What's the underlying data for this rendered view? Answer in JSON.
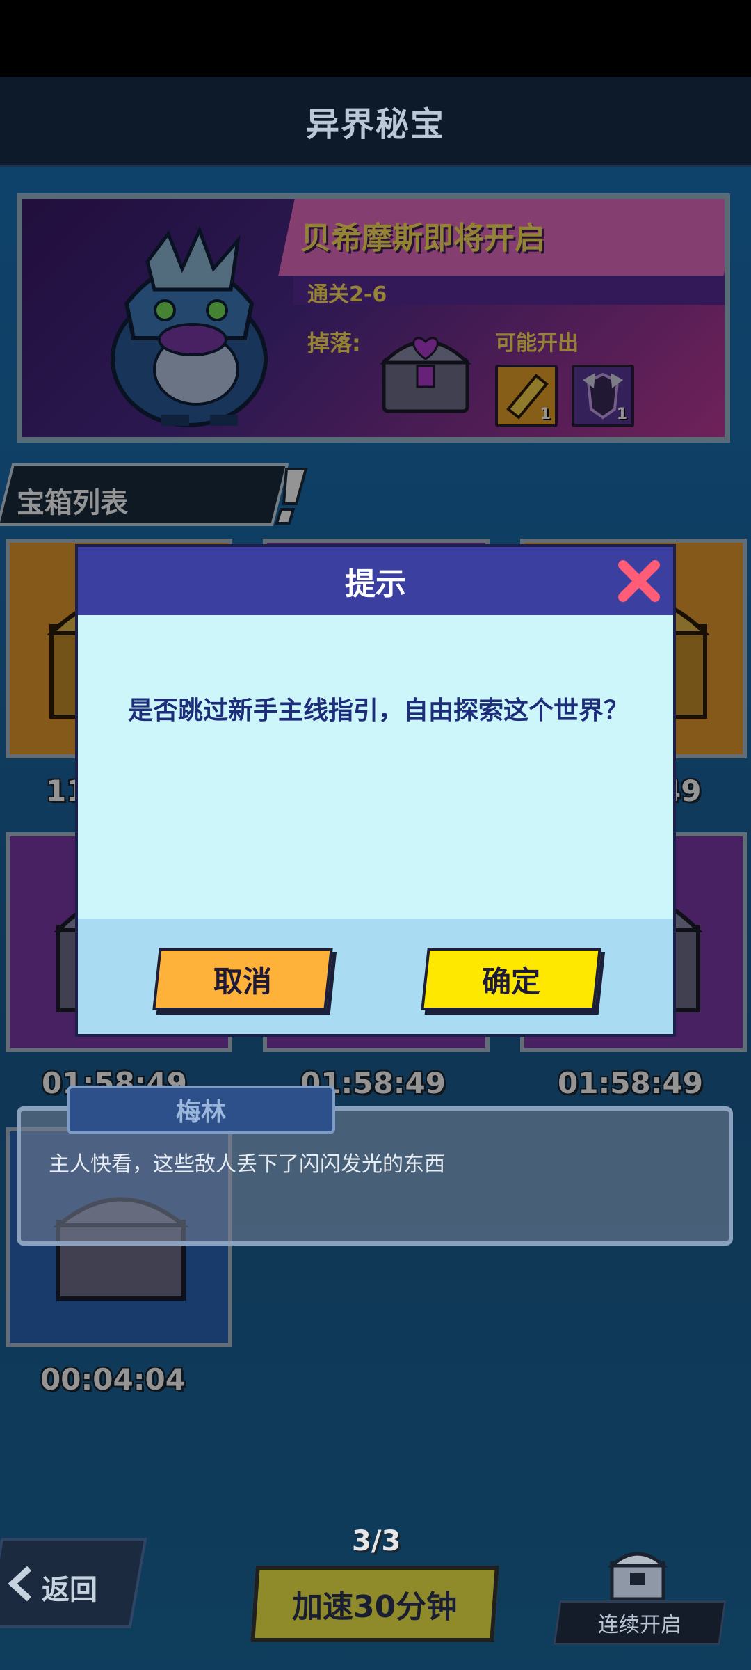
{
  "header": {
    "title": "异界秘宝"
  },
  "banner": {
    "boss_title": "贝希摩斯即将开启",
    "stage": "通关2-6",
    "drop_label": "掉落:",
    "possible_label": "可能开出",
    "rewards": [
      {
        "icon": "gold-ticket-icon",
        "count": "1"
      },
      {
        "icon": "purple-armor-icon",
        "count": "1"
      }
    ]
  },
  "chest_list": {
    "title": "宝箱列表",
    "timers": [
      "11",
      "49",
      "01:58:49",
      "01:58:49",
      "01:58:49",
      "00:04:04"
    ]
  },
  "dialog": {
    "title": "提示",
    "message": "是否跳过新手主线指引，自由探索这个世界？",
    "cancel_label": "取消",
    "confirm_label": "确定"
  },
  "npc": {
    "name": "梅林",
    "text": "主人快看，这些敌人丢下了闪闪发光的东西"
  },
  "bottom": {
    "back_label": "返回",
    "count": "3/3",
    "speed_label": "加速30分钟",
    "continuous_label": "连续开启"
  }
}
